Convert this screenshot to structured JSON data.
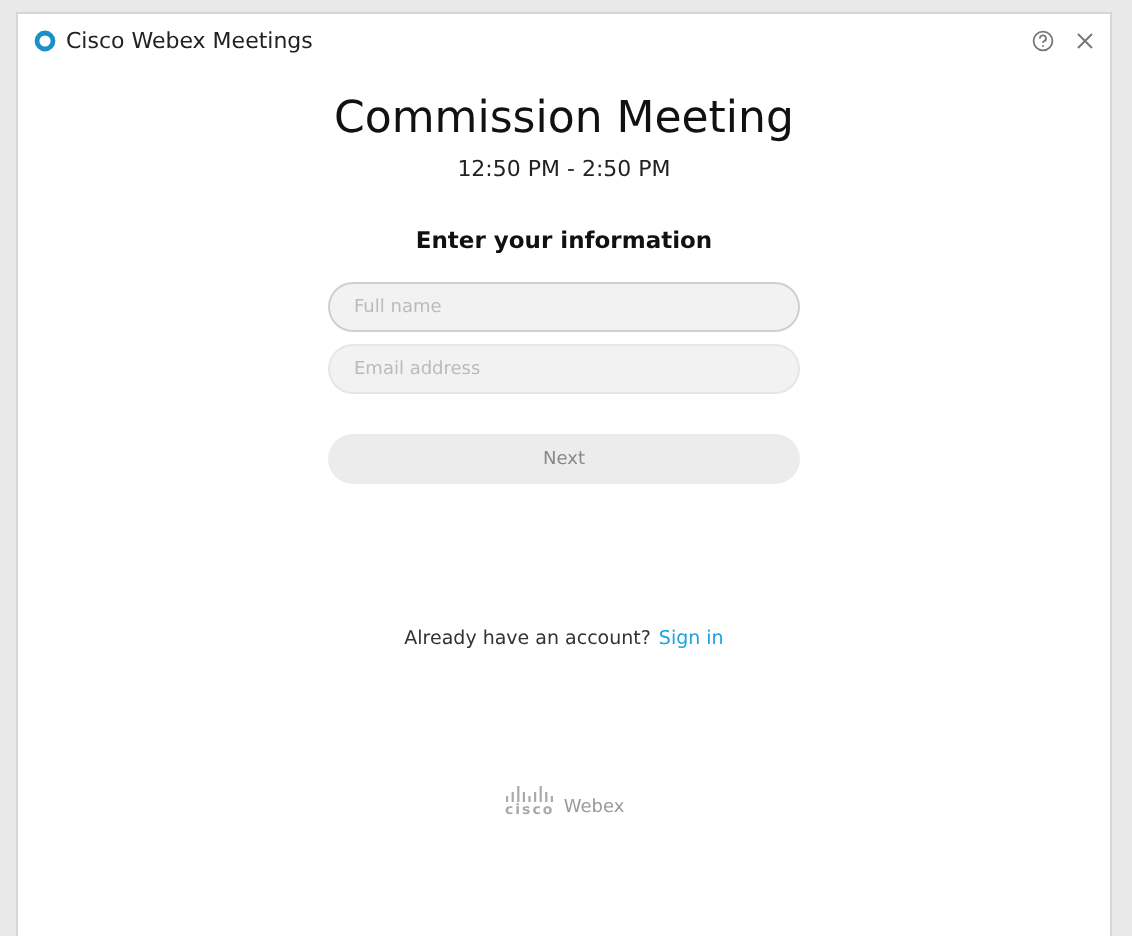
{
  "window": {
    "title": "Cisco Webex Meetings"
  },
  "meeting": {
    "title": "Commission Meeting",
    "time": "12:50 PM - 2:50 PM"
  },
  "form": {
    "heading": "Enter your information",
    "fields": [
      {
        "placeholder": "Full name",
        "focused": true
      },
      {
        "placeholder": "Email address",
        "focused": false
      }
    ],
    "button": {
      "label": "Next",
      "disabled": true
    }
  },
  "account": {
    "prompt": "Already have an account?",
    "link": "Sign in"
  },
  "logo": {
    "mark": "cisco",
    "product": "Webex"
  }
}
